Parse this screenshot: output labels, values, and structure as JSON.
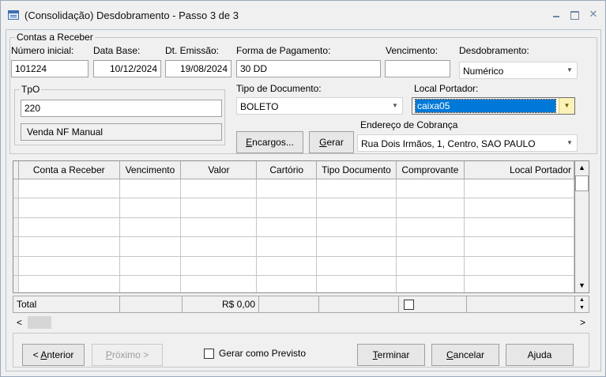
{
  "window": {
    "title": "(Consolidação) Desdobramento - Passo 3 de 3",
    "controls": {
      "minimize": "",
      "maximize": "",
      "close": "✕"
    }
  },
  "contas": {
    "group_label": "Contas a Receber",
    "numero_label": "Número inicial:",
    "numero_value": "101224",
    "data_base_label": "Data Base:",
    "data_base_value": "10/12/2024",
    "emissao_label": "Dt. Emissão:",
    "emissao_value": "19/08/2024",
    "forma_label": "Forma de Pagamento:",
    "forma_value": "30 DD",
    "vencimento_label": "Vencimento:",
    "vencimento_value": "",
    "desdobramento_label": "Desdobramento:",
    "desdobramento_value": "Numérico"
  },
  "tpo": {
    "group_label": "TpO",
    "code": "220",
    "description": "Venda NF Manual"
  },
  "tipo_documento": {
    "label": "Tipo de Documento:",
    "value": "BOLETO"
  },
  "local_portador": {
    "label": "Local Portador:",
    "value": "caixa05"
  },
  "endereco": {
    "label": "Endereço de Cobrança",
    "value": "Rua Dois Irmãos, 1, Centro, SAO PAULO"
  },
  "buttons": {
    "encargos": {
      "u": "E",
      "rest": "ncargos..."
    },
    "gerar": {
      "u": "G",
      "rest": "erar"
    },
    "anterior": {
      "pre": "< ",
      "u": "A",
      "rest": "nterior"
    },
    "proximo": {
      "u": "P",
      "rest": "róximo >"
    },
    "terminar": {
      "u": "T",
      "rest": "erminar"
    },
    "cancelar": {
      "u": "C",
      "rest": "ancelar"
    },
    "ajuda": "Ajuda"
  },
  "grid": {
    "columns": [
      "Conta a Receber",
      "Vencimento",
      "Valor",
      "Cartório",
      "Tipo Documento",
      "Comprovante",
      "Local Portador"
    ],
    "rows": 6,
    "scroll_up": "▲",
    "scroll_down": "▼"
  },
  "totals": {
    "label": "Total",
    "valor": "R$ 0,00"
  },
  "hscroll": {
    "left": "<",
    "right": ">"
  },
  "gerar_previsto": {
    "label": "Gerar como Previsto",
    "checked": false
  },
  "icons": {
    "window": "window-icon",
    "dropdown": "chevron-down-icon"
  }
}
